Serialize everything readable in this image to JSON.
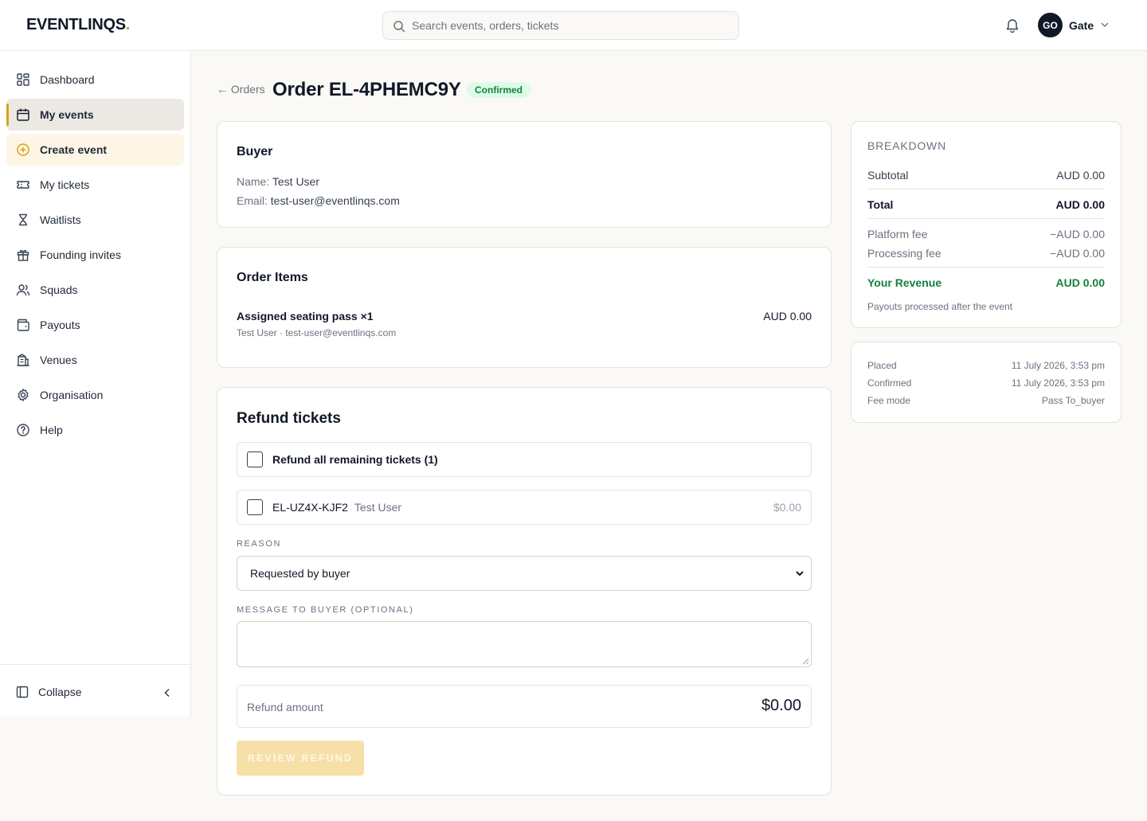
{
  "brand": {
    "name": "EVENTLINQS",
    "dot": "."
  },
  "search": {
    "placeholder": "Search events, orders, tickets"
  },
  "user": {
    "initials": "GO",
    "name": "Gate"
  },
  "sidebar": {
    "items": [
      {
        "label": "Dashboard",
        "icon": "dashboard-icon"
      },
      {
        "label": "My events",
        "icon": "calendar-icon",
        "active": true
      },
      {
        "label": "Create event",
        "icon": "plus-circle-icon"
      },
      {
        "label": "My tickets",
        "icon": "ticket-icon"
      },
      {
        "label": "Waitlists",
        "icon": "hourglass-icon"
      },
      {
        "label": "Founding invites",
        "icon": "gift-icon"
      },
      {
        "label": "Squads",
        "icon": "users-icon"
      },
      {
        "label": "Payouts",
        "icon": "wallet-icon"
      },
      {
        "label": "Venues",
        "icon": "building-icon"
      },
      {
        "label": "Organisation",
        "icon": "gear-icon"
      },
      {
        "label": "Help",
        "icon": "help-icon"
      }
    ],
    "collapse_label": "Collapse"
  },
  "header": {
    "back_label": "← Orders",
    "title": "Order EL-4PHEMC9Y",
    "status": "Confirmed"
  },
  "buyer": {
    "heading": "Buyer",
    "name_label": "Name:",
    "name": "Test User",
    "email_label": "Email:",
    "email": "test-user@eventlinqs.com"
  },
  "order_items": {
    "heading": "Order Items",
    "items": [
      {
        "name": "Assigned seating pass ×1",
        "sub": "Test User · test-user@eventlinqs.com",
        "price": "AUD 0.00"
      }
    ]
  },
  "refund": {
    "heading": "Refund tickets",
    "all_label": "Refund all remaining tickets (1)",
    "tickets": [
      {
        "code": "EL-UZ4X-KJF2",
        "holder": "Test User",
        "amount": "$0.00"
      }
    ],
    "reason_label": "REASON",
    "reason_value": "Requested by buyer",
    "message_label": "MESSAGE TO BUYER (OPTIONAL)",
    "message_value": "",
    "amount_label": "Refund amount",
    "amount_value": "$0.00",
    "review_button": "REVIEW REFUND"
  },
  "breakdown": {
    "heading": "BREAKDOWN",
    "subtotal_label": "Subtotal",
    "subtotal": "AUD 0.00",
    "total_label": "Total",
    "total": "AUD 0.00",
    "platform_fee_label": "Platform fee",
    "platform_fee": "−AUD 0.00",
    "processing_fee_label": "Processing fee",
    "processing_fee": "−AUD 0.00",
    "revenue_label": "Your Revenue",
    "revenue": "AUD 0.00",
    "note": "Payouts processed after the event"
  },
  "meta": {
    "placed_label": "Placed",
    "placed": "11 July 2026, 3:53 pm",
    "confirmed_label": "Confirmed",
    "confirmed": "11 July 2026, 3:53 pm",
    "fee_mode_label": "Fee mode",
    "fee_mode": "Pass To_buyer"
  },
  "colors": {
    "accent": "#d9a21b",
    "success": "#15803d",
    "success_bg": "#dcfce7",
    "ink": "#111827"
  }
}
